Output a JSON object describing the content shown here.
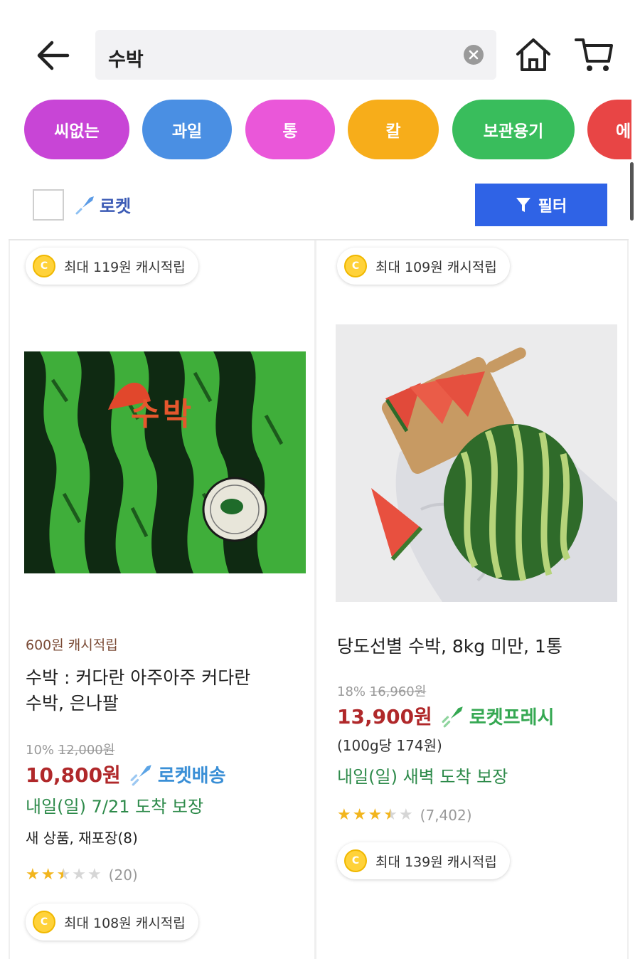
{
  "search": {
    "query": "수박"
  },
  "chips": [
    {
      "label": "씨없는",
      "color": "#c845d6"
    },
    {
      "label": "과일",
      "color": "#4a8fe3"
    },
    {
      "label": "통",
      "color": "#ea57d9"
    },
    {
      "label": "칼",
      "color": "#f7ad1a"
    },
    {
      "label": "보관용기",
      "color": "#39bd5c"
    },
    {
      "label": "에",
      "color": "#e84545"
    }
  ],
  "filters": {
    "rocket_label": "로켓",
    "filter_button": "필터"
  },
  "top_cash": {
    "left": "최대 119원 캐시적립",
    "right": "최대 109원 캐시적립"
  },
  "products": [
    {
      "cash_earn": "600원 캐시적립",
      "title_line1": "수박 : 커다란 아주아주 커다란",
      "title_line2": "수박, 은나팔",
      "discount_rate": "10%",
      "original_price": "12,000원",
      "price": "10,800원",
      "badge": "로켓배송",
      "badge_color": "#3a8fd6",
      "delivery": "내일(일) 7/21 도착 보장",
      "condition": "새 상품, 재포장(8)",
      "rating": 2.5,
      "reviews": "(20)",
      "max_cash": "최대 108원 캐시적립",
      "image_text": "수박"
    },
    {
      "title_line1": "당도선별 수박, 8kg 미만, 1통",
      "discount_rate": "18%",
      "original_price": "16,960원",
      "price": "13,900원",
      "badge": "로켓프레시",
      "badge_color": "#35a852",
      "unit_price": "(100g당 174원)",
      "delivery": "내일(일) 새벽 도착 보장",
      "rating": 3.5,
      "reviews": "(7,402)",
      "max_cash": "최대 139원 캐시적립"
    }
  ],
  "colors": {
    "price": "#b0282a",
    "delivery": "#2d8a4a",
    "filter_button": "#2f63e6",
    "star": "#f2b51d"
  }
}
